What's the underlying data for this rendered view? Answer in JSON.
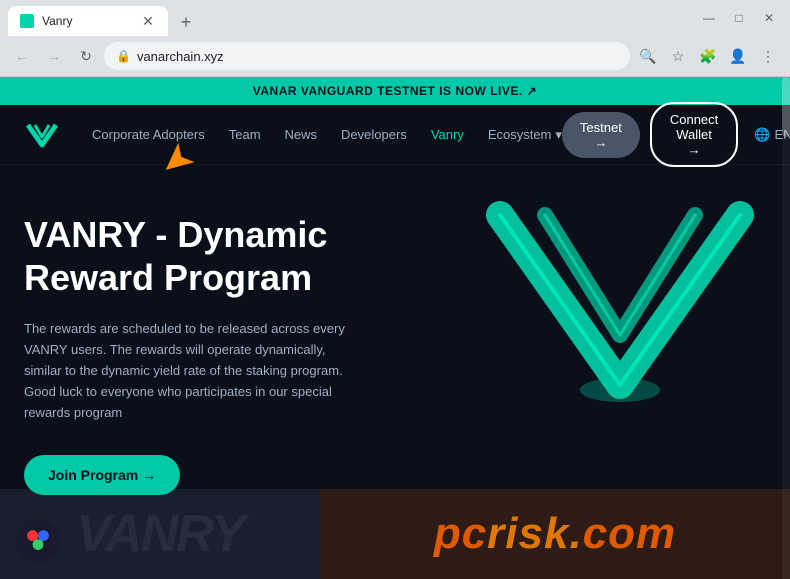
{
  "browser": {
    "tab_title": "Vanry",
    "url": "vanarchain.xyz",
    "new_tab_icon": "+",
    "back_icon": "←",
    "forward_icon": "→",
    "refresh_icon": "↻",
    "window_controls": [
      "—",
      "□",
      "✕"
    ]
  },
  "announcement": {
    "text": "VANAR VANGUARD TESTNET IS",
    "highlight": "NOW LIVE.",
    "ext_icon": "↗"
  },
  "nav": {
    "links": [
      {
        "label": "Corporate Adopters",
        "active": false
      },
      {
        "label": "Team",
        "active": false
      },
      {
        "label": "News",
        "active": false
      },
      {
        "label": "Developers",
        "active": false
      },
      {
        "label": "Vanry",
        "active": true
      },
      {
        "label": "Ecosystem",
        "active": false
      }
    ],
    "testnet_btn": "Testnet →",
    "connect_btn": "Connect Wallet →",
    "lang": "EN"
  },
  "hero": {
    "title": "VANRY - Dynamic\nReward Program",
    "description": "The rewards are scheduled to be released across every VANRY users. The rewards will operate dynamically, similar to the dynamic yield rate of the staking program. Good luck to everyone who participates in our special rewards program",
    "join_btn": "Join Program →"
  },
  "watermark": {
    "logo_dots": "⬤",
    "pcrisk": "pcrisk.com"
  }
}
